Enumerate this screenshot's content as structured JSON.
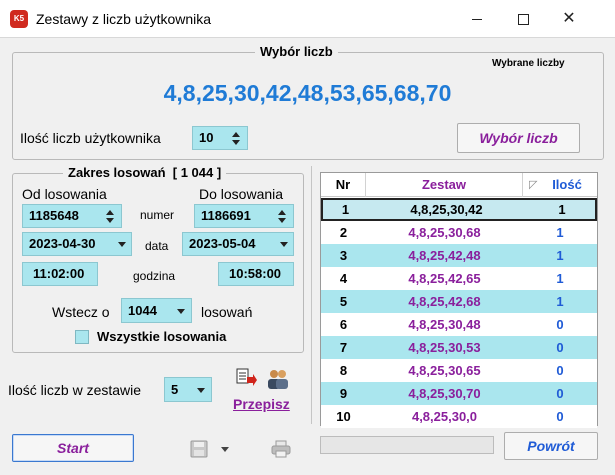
{
  "window": {
    "title": "Zestawy z liczb użytkownika",
    "icon_text": "K5"
  },
  "selection": {
    "group_title": "Wybór liczb",
    "selected_label": "Wybrane liczby",
    "selected_numbers": "4,8,25,30,42,48,53,65,68,70",
    "count_label": "Ilość liczb użytkownika",
    "count_value": "10",
    "choose_button": "Wybór liczb"
  },
  "range": {
    "group_title": "Zakres losowań  [ 1 044 ]",
    "from_label": "Od losowania",
    "to_label": "Do losowania",
    "number_label": "numer",
    "from_number": "1185648",
    "to_number": "1186691",
    "date_label": "data",
    "from_date": "2023-04-30",
    "to_date": "2023-05-04",
    "time_label": "godzina",
    "from_time": "11:02:00",
    "to_time": "10:58:00",
    "back_label": "Wstecz o",
    "back_value": "1044",
    "back_suffix": "losowań",
    "all_label": "Wszystkie losowania"
  },
  "set_size": {
    "label": "Ilość liczb w zestawie",
    "value": "5"
  },
  "actions": {
    "copy_label": "Przepisz",
    "start_label": "Start",
    "back_label": "Powrót"
  },
  "table": {
    "headers": {
      "nr": "Nr",
      "set": "Zestaw",
      "count": "Ilość"
    },
    "rows": [
      {
        "nr": "1",
        "set": "4,8,25,30,42",
        "count": "1"
      },
      {
        "nr": "2",
        "set": "4,8,25,30,68",
        "count": "1"
      },
      {
        "nr": "3",
        "set": "4,8,25,42,48",
        "count": "1"
      },
      {
        "nr": "4",
        "set": "4,8,25,42,65",
        "count": "1"
      },
      {
        "nr": "5",
        "set": "4,8,25,42,68",
        "count": "1"
      },
      {
        "nr": "6",
        "set": "4,8,25,30,48",
        "count": "0"
      },
      {
        "nr": "7",
        "set": "4,8,25,30,53",
        "count": "0"
      },
      {
        "nr": "8",
        "set": "4,8,25,30,65",
        "count": "0"
      },
      {
        "nr": "9",
        "set": "4,8,25,30,70",
        "count": "0"
      },
      {
        "nr": "10",
        "set": "4,8,25,30,0",
        "count": "0"
      }
    ]
  },
  "colors": {
    "accent_blue": "#1f7bd6",
    "set_purple": "#8a1f9c",
    "count_blue": "#1f5bd6",
    "row_cyan": "#aae6ee",
    "row_white": "#ffffff"
  }
}
